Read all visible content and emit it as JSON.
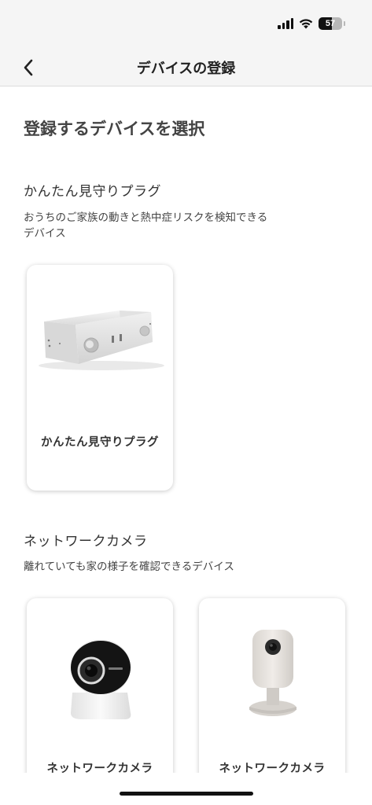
{
  "status_bar": {
    "battery_level": "57",
    "battery_fraction": 0.57
  },
  "nav": {
    "title": "デバイスの登録",
    "back_icon": "chevron-left-icon"
  },
  "page": {
    "heading": "登録するデバイスを選択"
  },
  "sections": [
    {
      "title": "かんたん見守りプラグ",
      "description_line1": "おうちのご家族の動きと熱中症リスクを検知できる",
      "description_line2": "デバイス",
      "cards": [
        {
          "label": "かんたん見守りプラグ"
        }
      ]
    },
    {
      "title": "ネットワークカメラ",
      "description_line1": "離れていても家の様子を確認できるデバイス",
      "cards": [
        {
          "label": "ネットワークカメラ"
        },
        {
          "label": "ネットワークカメラ"
        }
      ]
    }
  ]
}
